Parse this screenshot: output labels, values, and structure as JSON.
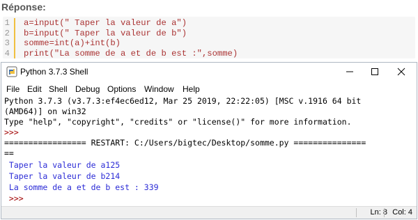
{
  "heading": "Réponse:",
  "code": {
    "lines": [
      {
        "num": "1",
        "text": "a=input(\" Taper la valeur de a\")"
      },
      {
        "num": "2",
        "text": "b=input(\" Taper la valeur de b\")"
      },
      {
        "num": "3",
        "text": "somme=int(a)+int(b)"
      },
      {
        "num": "4",
        "text": "print(\"La somme de a et de b est :\",somme)"
      }
    ]
  },
  "shell": {
    "window_title": "Python 3.7.3 Shell",
    "menu": [
      "File",
      "Edit",
      "Shell",
      "Debug",
      "Options",
      "Window",
      "Help"
    ],
    "lines": [
      {
        "text": "Python 3.7.3 (v3.7.3:ef4ec6ed12, Mar 25 2019, 22:22:05) [MSC v.1916 64 bit",
        "kind": "normal"
      },
      {
        "text": "(AMD64)] on win32",
        "kind": "normal"
      },
      {
        "text": "Type \"help\", \"copyright\", \"credits\" or \"license()\" for more information.",
        "kind": "normal"
      },
      {
        "text": ">>> ",
        "kind": "prompt"
      },
      {
        "text": "================= RESTART: C:/Users/bigtec/Desktop/somme.py ===============",
        "kind": "normal"
      },
      {
        "text": "==",
        "kind": "normal"
      },
      {
        "text": " Taper la valeur de a125",
        "kind": "out"
      },
      {
        "text": " Taper la valeur de b214",
        "kind": "out"
      },
      {
        "text": " La somme de a et de b est : 339",
        "kind": "out"
      },
      {
        "text": " >>> ",
        "kind": "prompt"
      }
    ],
    "status": {
      "line": "Ln: 8",
      "col": "Col: 4"
    }
  }
}
